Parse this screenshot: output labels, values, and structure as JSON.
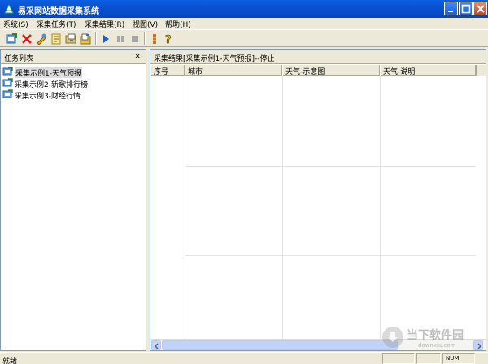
{
  "window": {
    "title": "易采网站数据采集系统"
  },
  "menu": {
    "items": [
      "系统(S)",
      "采集任务(T)",
      "采集结果(R)",
      "视图(V)",
      "帮助(H)"
    ]
  },
  "toolbar": {
    "icons": [
      "new-task-icon",
      "delete-icon",
      "edit-icon",
      "properties-icon",
      "import-icon",
      "export-icon",
      "start-icon",
      "pause-icon",
      "stop-icon",
      "log-icon",
      "help-icon"
    ]
  },
  "task_panel": {
    "title": "任务列表",
    "close": "×",
    "items": [
      {
        "label": "采集示例1-天气预报",
        "selected": true
      },
      {
        "label": "采集示例2-新歌排行榜",
        "selected": false
      },
      {
        "label": "采集示例3-财经行情",
        "selected": false
      }
    ]
  },
  "results_panel": {
    "title": "采集结果[采集示例1-天气预报]--停止",
    "columns": [
      "序号",
      "城市",
      "天气-示意图",
      "天气-说明"
    ]
  },
  "statusbar": {
    "text": "就绪",
    "num": "NUM"
  },
  "watermark": {
    "text": "当下软件园",
    "sub": "downxia.com"
  },
  "colors": {
    "titlebar": "#0a4fd0",
    "face": "#ece9d8",
    "border": "#7f9db9"
  }
}
